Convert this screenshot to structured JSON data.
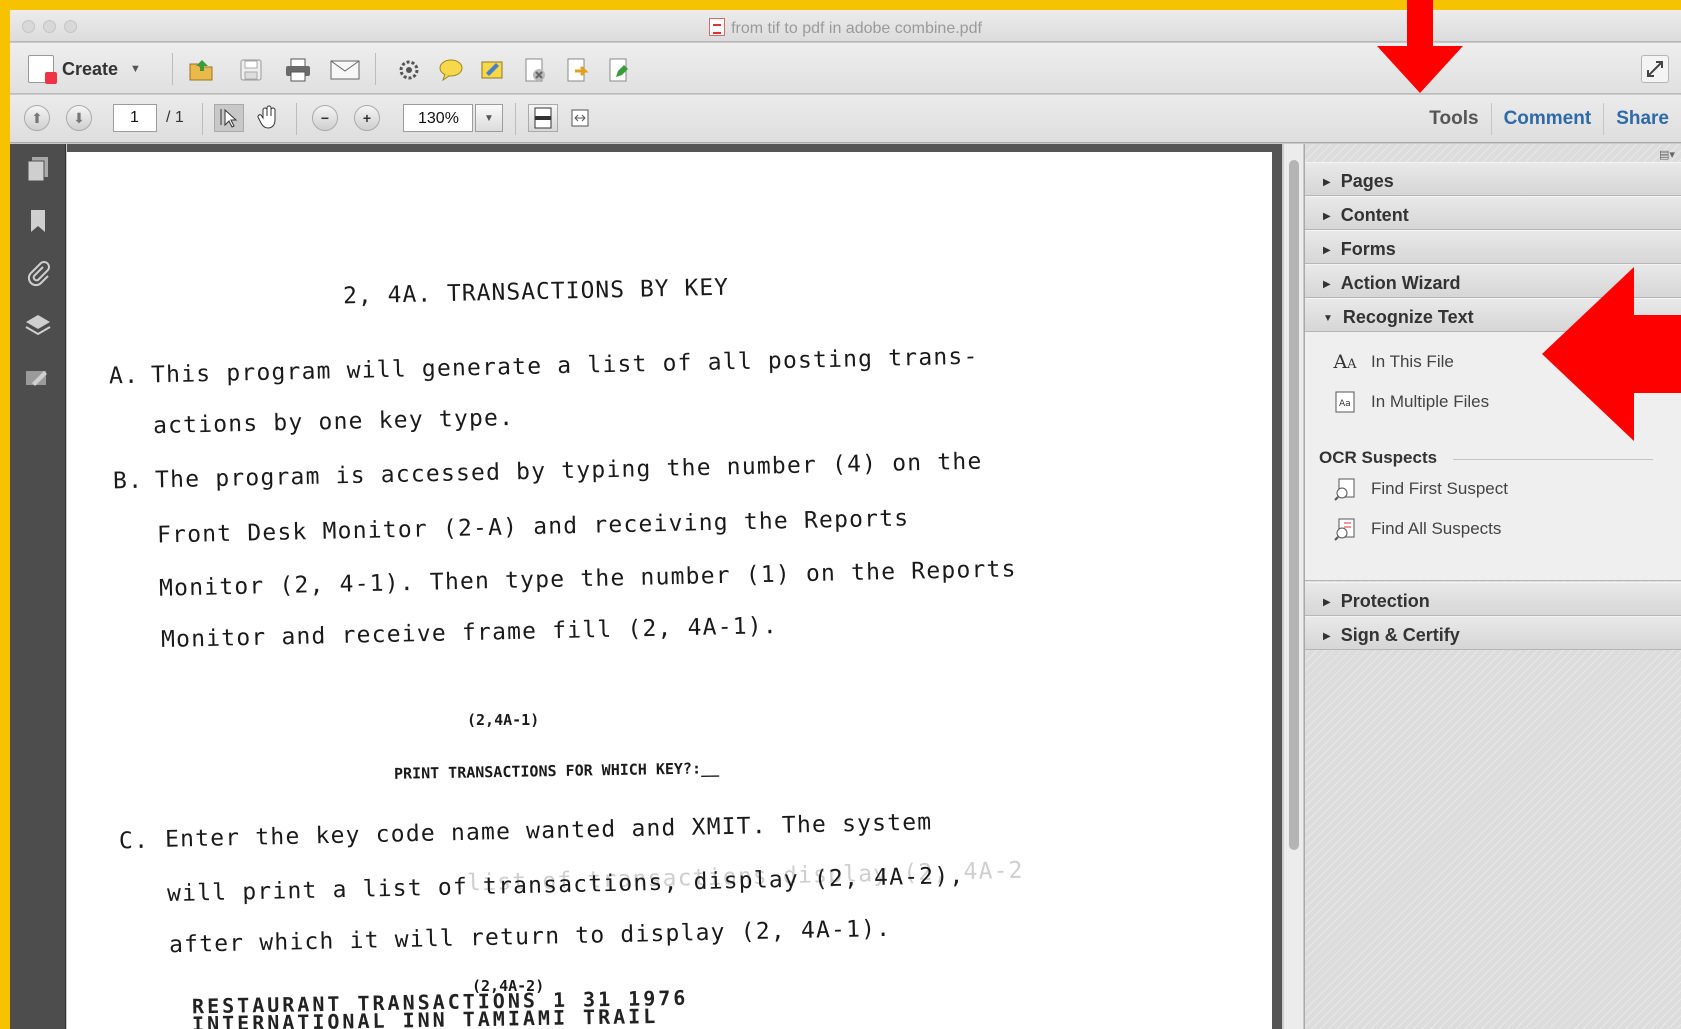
{
  "window": {
    "title": "from tif to pdf in adobe combine.pdf"
  },
  "toolbar": {
    "create_label": "Create",
    "icons": [
      "open-icon",
      "save-icon",
      "print-icon",
      "email-icon",
      "settings-icon",
      "comment-icon",
      "sign-icon",
      "delete-icon",
      "export-icon",
      "edit-icon"
    ]
  },
  "nav_toolbar": {
    "page_current": "1",
    "page_total": "/ 1",
    "zoom": "130%"
  },
  "tabs": {
    "tools": "Tools",
    "comment": "Comment",
    "share": "Share"
  },
  "document": {
    "heading": "2, 4A. TRANSACTIONS BY KEY",
    "paragraph_a_label": "A.",
    "paragraph_a_line1": "This program will generate a list of all posting trans-",
    "paragraph_a_line2": "actions by one key type.",
    "paragraph_b_label": "B.",
    "paragraph_b_line1": "The program is accessed by typing the number (4) on the",
    "paragraph_b_line2": "Front Desk Monitor (2-A) and receiving the Reports",
    "paragraph_b_line3": "Monitor (2, 4-1).  Then type the number (1) on the Reports",
    "paragraph_b_line4": "Monitor and receive frame fill (2, 4A-1).",
    "frame_ref_1": "(2,4A-1)",
    "prompt_line": "PRINT TRANSACTIONS FOR WHICH KEY?:__",
    "paragraph_c_label": "C.",
    "paragraph_c_line1": "Enter the key code name wanted and XMIT.  The system",
    "paragraph_c_line2": "will print a list of transactions, display (2, 4A-2),",
    "paragraph_c_line3": "after which it will return to display (2, 4A-1).",
    "bleed_text": "list of transactions display (2, 4A-2",
    "frame_ref_2": "(2,4A-2)",
    "print_line1": "RESTAURANT TRANSACTIONS    1 31 1976",
    "print_line2": "INTERNATIONAL INN TAMIAMI TRAIL"
  },
  "panel": {
    "sections": [
      "Pages",
      "Content",
      "Forms",
      "Action Wizard",
      "Recognize Text",
      "Protection",
      "Sign & Certify"
    ],
    "recognize_items": [
      "In This File",
      "In Multiple Files"
    ],
    "ocr_heading": "OCR Suspects",
    "ocr_items": [
      "Find First Suspect",
      "Find All Suspects"
    ]
  },
  "colors": {
    "background_frame": "#f7c300",
    "annotation_arrows": "#ff0000",
    "link_blue": "#2e6aa8"
  }
}
